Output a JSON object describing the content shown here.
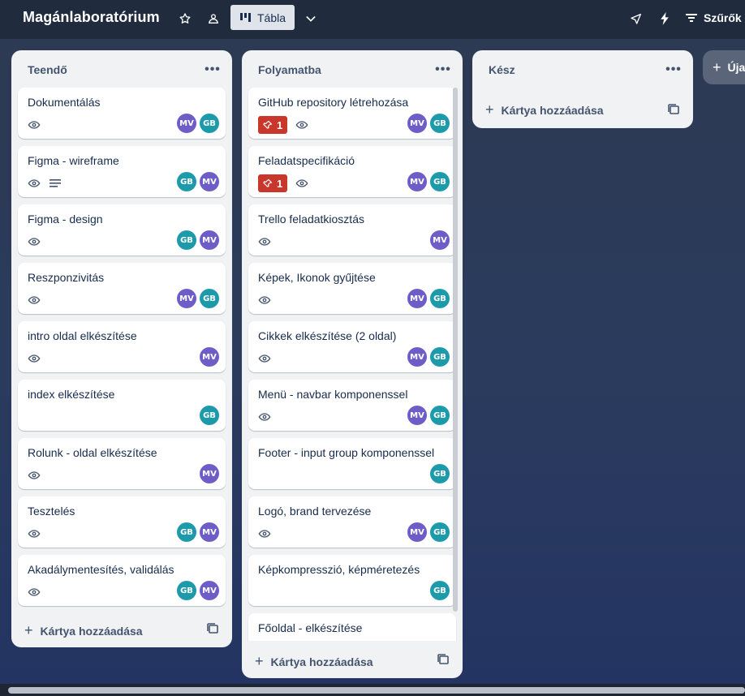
{
  "header": {
    "board_title": "Magánlaboratórium",
    "view_label": "Tábla",
    "filter_label": "Szűrők",
    "icons": [
      "star-icon",
      "workspace-icon",
      "board-view-icon",
      "chevron-down-icon",
      "power-ups-icon",
      "automation-icon",
      "filter-icon"
    ]
  },
  "lists": [
    {
      "title": "Teendő",
      "add_card_label": "Kártya hozzáadása",
      "cards": [
        {
          "title": "Dokumentálás",
          "badges": [
            "watch"
          ],
          "members": [
            "MV",
            "GB"
          ]
        },
        {
          "title": "Figma - wireframe",
          "badges": [
            "watch",
            "description"
          ],
          "members": [
            "GB",
            "MV"
          ]
        },
        {
          "title": "Figma - design",
          "badges": [
            "watch"
          ],
          "members": [
            "GB",
            "MV"
          ]
        },
        {
          "title": "Reszponzivitás",
          "badges": [
            "watch"
          ],
          "members": [
            "MV",
            "GB"
          ]
        },
        {
          "title": "intro oldal elkészítése",
          "badges": [
            "watch"
          ],
          "members": [
            "MV"
          ]
        },
        {
          "title": "index elkészítése",
          "badges": [],
          "members": [
            "GB"
          ]
        },
        {
          "title": "Rolunk - oldal elkészítése",
          "badges": [
            "watch"
          ],
          "members": [
            "MV"
          ]
        },
        {
          "title": "Tesztelés",
          "badges": [
            "watch"
          ],
          "members": [
            "GB",
            "MV"
          ]
        },
        {
          "title": "Akadálymentesítés, validálás",
          "badges": [
            "watch"
          ],
          "members": [
            "GB",
            "MV"
          ]
        }
      ]
    },
    {
      "title": "Folyamatba",
      "add_card_label": "Kártya hozzáadása",
      "cards": [
        {
          "title": "GitHub repository létrehozása",
          "priority": "1",
          "badges": [
            "watch"
          ],
          "members": [
            "MV",
            "GB"
          ]
        },
        {
          "title": "Feladatspecifikáció",
          "priority": "1",
          "badges": [
            "watch"
          ],
          "members": [
            "MV",
            "GB"
          ]
        },
        {
          "title": "Trello feladatkiosztás",
          "badges": [
            "watch"
          ],
          "members": [
            "MV"
          ]
        },
        {
          "title": "Képek, Ikonok gyűjtése",
          "badges": [
            "watch"
          ],
          "members": [
            "MV",
            "GB"
          ]
        },
        {
          "title": "Cikkek elkészítése (2 oldal)",
          "badges": [
            "watch"
          ],
          "members": [
            "MV",
            "GB"
          ]
        },
        {
          "title": "Menü - navbar komponenssel",
          "badges": [
            "watch"
          ],
          "members": [
            "MV",
            "GB"
          ]
        },
        {
          "title": "Footer - input group komponenssel",
          "badges": [],
          "members": [
            "GB"
          ]
        },
        {
          "title": "Logó, brand tervezése",
          "badges": [
            "watch"
          ],
          "members": [
            "MV",
            "GB"
          ]
        },
        {
          "title": "Képkompresszió, képméretezés",
          "badges": [],
          "members": [
            "GB"
          ]
        },
        {
          "title": "Főoldal - elkészítése",
          "badges": [],
          "members": []
        }
      ]
    },
    {
      "title": "Kész",
      "add_card_label": "Kártya hozzáadása",
      "cards": []
    }
  ],
  "add_list_label": "Úja",
  "colors": {
    "priority": "#c9372c",
    "avatar_mv": "#6e5dc6",
    "avatar_gb": "#1d9aaa"
  }
}
